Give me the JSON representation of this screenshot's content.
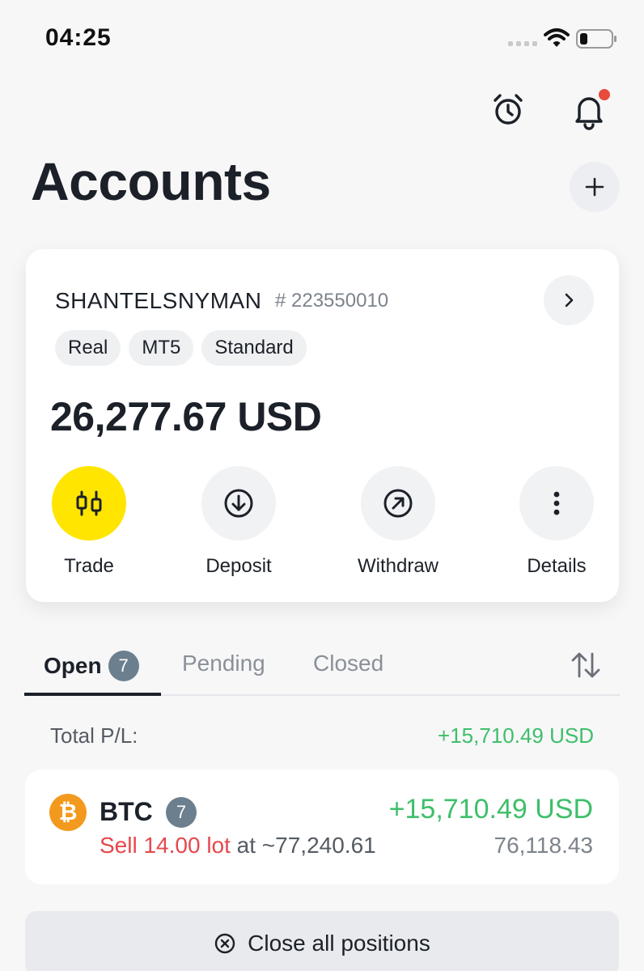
{
  "status_bar": {
    "time": "04:25"
  },
  "header": {
    "title": "Accounts"
  },
  "account": {
    "name": "SHANTELSNYMAN",
    "number": "# 223550010",
    "tags": [
      "Real",
      "MT5",
      "Standard"
    ],
    "balance": "26,277.67 USD",
    "actions": {
      "trade": "Trade",
      "deposit": "Deposit",
      "withdraw": "Withdraw",
      "details": "Details"
    }
  },
  "tabs": {
    "open": "Open",
    "open_count": "7",
    "pending": "Pending",
    "closed": "Closed"
  },
  "total": {
    "label": "Total P/L:",
    "value": "+15,710.49 USD"
  },
  "position": {
    "icon_glyph": "₿",
    "symbol": "BTC",
    "count": "7",
    "pl": "+15,710.49 USD",
    "side_lot": "Sell 14.00 lot",
    "at_price": " at ~77,240.61",
    "current_price": "76,118.43"
  },
  "close_all": {
    "label": "Close all positions"
  },
  "colors": {
    "profit": "#3dbf6a",
    "sell": "#e5484d",
    "trade_accent": "#ffe500",
    "btc": "#f39a1e"
  }
}
